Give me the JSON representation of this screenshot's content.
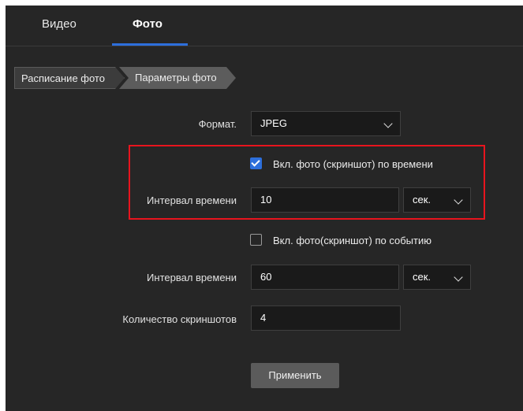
{
  "tabs": [
    {
      "label": "Видео",
      "active": false
    },
    {
      "label": "Фото",
      "active": true
    }
  ],
  "steps": [
    {
      "label": "Расписание фото"
    },
    {
      "label": "Параметры фото"
    }
  ],
  "form": {
    "format_label": "Формат.",
    "format_value": "JPEG",
    "timed_checkbox_label": "Вкл. фото (скриншот) по времени",
    "timed_checked": true,
    "timed_interval_label": "Интервал времени",
    "timed_interval_value": "10",
    "timed_interval_unit": "сек.",
    "event_checkbox_label": "Вкл. фото(скриншот) по событию",
    "event_checked": false,
    "event_interval_label": "Интервал времени",
    "event_interval_value": "60",
    "event_interval_unit": "сек.",
    "count_label": "Количество скриншотов",
    "count_value": "4",
    "apply_label": "Применить"
  },
  "colors": {
    "accent": "#2d6fdc",
    "highlight_border": "#e8141e",
    "background": "#262626"
  }
}
